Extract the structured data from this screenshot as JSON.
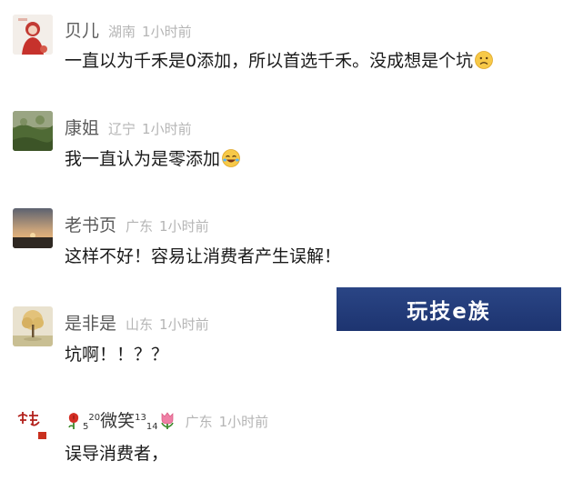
{
  "comments": [
    {
      "name": "贝儿",
      "location": "湖南",
      "time": "1小时前",
      "text": "一直以为千禾是0添加，所以首选千禾。没成想是个坑",
      "emoji": "sad-face-emoji"
    },
    {
      "name": "康姐",
      "location": "辽宁",
      "time": "1小时前",
      "text": "我一直认为是零添加",
      "emoji": "laughing-tears-emoji"
    },
    {
      "name": "老书页",
      "location": "广东",
      "time": "1小时前",
      "text": "这样不好！容易让消费者产生误解！"
    },
    {
      "name": "是非是",
      "location": "山东",
      "time": "1小时前",
      "text": "坑啊！！？？"
    },
    {
      "name_parts": {
        "sup_left": "5",
        "sup_mid": "20",
        "word": "微笑",
        "sup_right": "13",
        "sub_right": "14"
      },
      "location": "广东",
      "time": "1小时前",
      "text": "误导消费者，",
      "avatar_text": "善本"
    }
  ],
  "watermark": {
    "text": "玩技e族",
    "color": "#22397a"
  }
}
